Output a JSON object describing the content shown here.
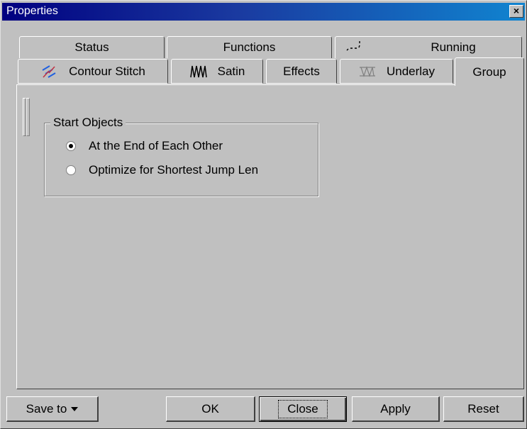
{
  "window": {
    "title": "Properties",
    "close_glyph": "×"
  },
  "tabs_row1": [
    "Status",
    "Functions",
    "Running"
  ],
  "tabs_row2": [
    "Contour Stitch",
    "Satin",
    "Effects",
    "Underlay",
    "Group"
  ],
  "active_tab": "Group",
  "group": {
    "legend": "Start Objects",
    "options": [
      {
        "label": "At the End of Each Other",
        "selected": true
      },
      {
        "label": "Optimize for Shortest Jump Len",
        "selected": false
      }
    ]
  },
  "buttons": {
    "save_to": "Save to",
    "ok": "OK",
    "close": "Close",
    "apply": "Apply",
    "reset": "Reset"
  },
  "icons": {
    "running": "running-stitch-icon",
    "contour": "contour-stitch-icon",
    "satin": "satin-stitch-icon",
    "underlay": "underlay-icon"
  },
  "colors": {
    "title_start": "#000080",
    "title_end": "#1084d0",
    "face": "#c0c0c0"
  }
}
